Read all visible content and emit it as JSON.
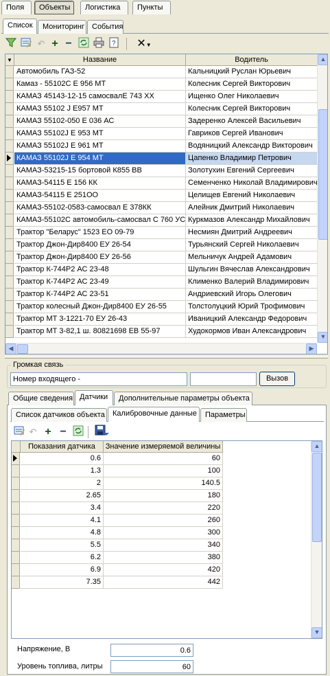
{
  "top_tabs": [
    "Поля",
    "Объекты",
    "Логистика",
    "Пункты"
  ],
  "sub_tabs": [
    "Список",
    "Мониторинг",
    "События"
  ],
  "toolbar_icons": [
    "filter-icon",
    "edit-icon",
    "undo-icon",
    "add-icon",
    "remove-icon",
    "refresh-icon",
    "print-icon",
    "help-icon",
    "delete-menu-icon"
  ],
  "objects_table": {
    "columns": [
      "Название",
      "Водитель"
    ],
    "rows": [
      {
        "name": "Автомобиль ГАЗ-52",
        "driver": "Кальницкий Руслан Юрьевич"
      },
      {
        "name": "Камаз - 55102С Е 956 МТ",
        "driver": "Колесник Сергей Викторович"
      },
      {
        "name": "КАМАЗ 45143-12-15 самосвалЕ 743 ХХ",
        "driver": "Ищенко Олег Николаевич"
      },
      {
        "name": "КАМАЗ 55102 J  Е957 МТ",
        "driver": "Колесник Сергей Викторович"
      },
      {
        "name": "КАМАЗ 55102-050 Е 036 АС",
        "driver": "Задеренко Алексей Васильевич"
      },
      {
        "name": "КАМАЗ 55102J   Е 953 МТ",
        "driver": "Гавриков Сергей Иванович"
      },
      {
        "name": "КАМАЗ 55102J   Е 961 МТ",
        "driver": "Водяницкий Александр Викторович"
      },
      {
        "name": "КАМАЗ 55102J Е 954 МТ",
        "driver": "Цапенко Владимир Петрович"
      },
      {
        "name": "КАМАЗ-53215-15 бортовой К855 ВВ",
        "driver": "Золотухин Евгений Сергеевич"
      },
      {
        "name": "КАМАЗ-54115 Е 156 КК",
        "driver": "Семенченко Николай Владимирович"
      },
      {
        "name": "КАМАЗ-54115 Е 251ОО",
        "driver": "Целищев Евгений Николаевич"
      },
      {
        "name": "КАМАЗ-55102-0583-самосвал Е 378КК",
        "driver": "Алейник Дмитрий Николаевич"
      },
      {
        "name": "КАМАЗ-55102С автомобиль-самосвал С 760 УС",
        "driver": "Куркмазов Александр Михайлович"
      },
      {
        "name": "Трактор \"Беларус\" 1523 ЕО 09-79",
        "driver": "Несмиян Дмитрий Андреевич"
      },
      {
        "name": "Трактор Джон-Дир8400 ЕУ 26-54",
        "driver": "Турьянский Сергей Николаевич"
      },
      {
        "name": "Трактор Джон-Дир8400 ЕУ 26-56",
        "driver": "Мельничук Андрей Адамович"
      },
      {
        "name": "Трактор К-744Р2 АС 23-48",
        "driver": "Шульгин Вячеслав Александрович"
      },
      {
        "name": "Трактор К-744Р2 АС 23-49",
        "driver": "Клименко Валерий Владимирович"
      },
      {
        "name": "Трактор К-744Р2 АС 23-51",
        "driver": "Андриевский Игорь Олегович"
      },
      {
        "name": "Трактор колесный Джон-Дир8400 ЕУ 26-55",
        "driver": "Толстолуцкий Юрий Трофимович"
      },
      {
        "name": "Трактор МТ 3-1221-70 ЕУ 26-43",
        "driver": "Иваницкий Александр Федорович"
      },
      {
        "name": "Трактор МТ 3-82,1 ш. 80821698 ЕВ 55-97",
        "driver": "Худокормов Иван Александрович"
      }
    ],
    "selected_index": 7
  },
  "loud_comm": {
    "legend": "Громкая связь",
    "incoming_value": "Номер входящего -",
    "second_value": "",
    "call_button": "Вызов"
  },
  "detail_tabs": [
    "Общие сведения",
    "Датчики",
    "Дополнительные параметры объекта"
  ],
  "sensor_tabs": [
    "Список датчиков объекта",
    "Калибровочные данные",
    "Параметры"
  ],
  "calib_toolbar_icons": [
    "edit-icon",
    "undo-icon",
    "add-icon",
    "remove-icon",
    "refresh-icon",
    "save-icon"
  ],
  "calib_table": {
    "columns": [
      "Показания датчика",
      "Значение измеряемой величины"
    ],
    "rows": [
      {
        "reading": "0.6",
        "value": "60"
      },
      {
        "reading": "1.3",
        "value": "100"
      },
      {
        "reading": "2",
        "value": "140.5"
      },
      {
        "reading": "2.65",
        "value": "180"
      },
      {
        "reading": "3.4",
        "value": "220"
      },
      {
        "reading": "4.1",
        "value": "260"
      },
      {
        "reading": "4.8",
        "value": "300"
      },
      {
        "reading": "5.5",
        "value": "340"
      },
      {
        "reading": "6.2",
        "value": "380"
      },
      {
        "reading": "6.9",
        "value": "420"
      },
      {
        "reading": "7.35",
        "value": "442"
      }
    ]
  },
  "fields": {
    "voltage_label": "Напряжение, В",
    "voltage_value": "0.6",
    "fuel_label": "Уровень топлива, литры",
    "fuel_value": "60"
  }
}
